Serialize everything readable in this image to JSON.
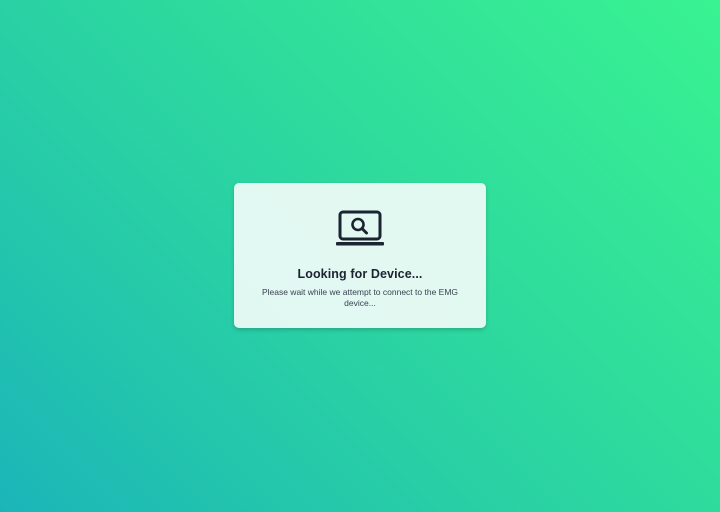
{
  "dialog": {
    "icon": "laptop-search-icon",
    "title": "Looking for Device...",
    "message": "Please wait while we attempt to connect to the EMG device..."
  },
  "colors": {
    "background_top_right": "#39f391",
    "background_bottom_left": "#1bb5b9",
    "card_background": "#f0fbf8",
    "title_text": "#1c2431",
    "icon": "#1c2431"
  }
}
